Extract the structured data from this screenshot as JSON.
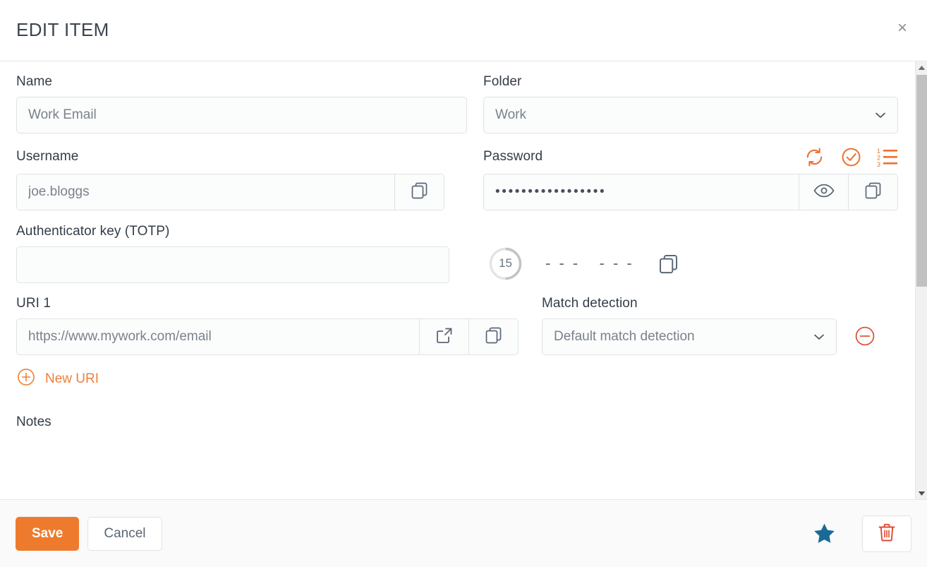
{
  "header": {
    "title": "EDIT ITEM",
    "close_label": "×"
  },
  "form": {
    "name": {
      "label": "Name",
      "value": "Work Email"
    },
    "folder": {
      "label": "Folder",
      "value": "Work"
    },
    "username": {
      "label": "Username",
      "value": "joe.bloggs",
      "copy_icon": "copy-icon"
    },
    "password": {
      "label": "Password",
      "value": "•••••••••••••••••",
      "toggle_icon": "eye-icon",
      "copy_icon": "copy-icon",
      "actions": [
        {
          "name": "generate-password-icon",
          "title": "Generate password"
        },
        {
          "name": "check-password-icon",
          "title": "Check password"
        },
        {
          "name": "password-history-icon",
          "title": "Password history"
        }
      ]
    },
    "totp": {
      "label": "Authenticator key (TOTP)",
      "value": "",
      "countdown": "15",
      "code": "- - -   - - -",
      "copy_icon": "copy-icon"
    },
    "uri": {
      "label": "URI 1",
      "value": "https://www.mywork.com/email",
      "launch_icon": "launch-icon",
      "copy_icon": "copy-icon",
      "remove_icon": "minus-circle-icon"
    },
    "match_detection": {
      "label": "Match detection",
      "value": "Default match detection"
    },
    "new_uri": {
      "label": "New URI",
      "icon": "plus-circle-icon"
    },
    "notes": {
      "label": "Notes"
    }
  },
  "footer": {
    "save_label": "Save",
    "cancel_label": "Cancel",
    "favorite_icon": "star-icon",
    "delete_icon": "trash-icon"
  },
  "colors": {
    "accent_orange": "#ee7b2d",
    "danger_red": "#e04a32",
    "favorite_blue": "#1b6a96",
    "icon_gray": "#5b6776",
    "label_dark": "#333c47"
  }
}
